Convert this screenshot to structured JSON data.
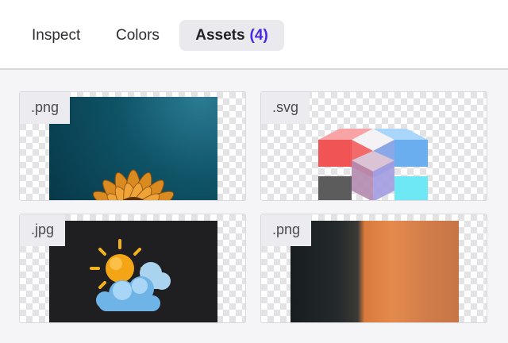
{
  "tabs": {
    "inspect": "Inspect",
    "colors": "Colors",
    "assets": "Assets",
    "assets_count": "(4)"
  },
  "assets": [
    {
      "ext": ".png",
      "thumb": "flower-image"
    },
    {
      "ext": ".svg",
      "thumb": "cubes-image"
    },
    {
      "ext": ".jpg",
      "thumb": "weather-icon"
    },
    {
      "ext": ".png",
      "thumb": "blurry-orange-image"
    }
  ],
  "colors": {
    "accent": "#4a27e5",
    "active_tab_bg": "#e9e9ee"
  }
}
